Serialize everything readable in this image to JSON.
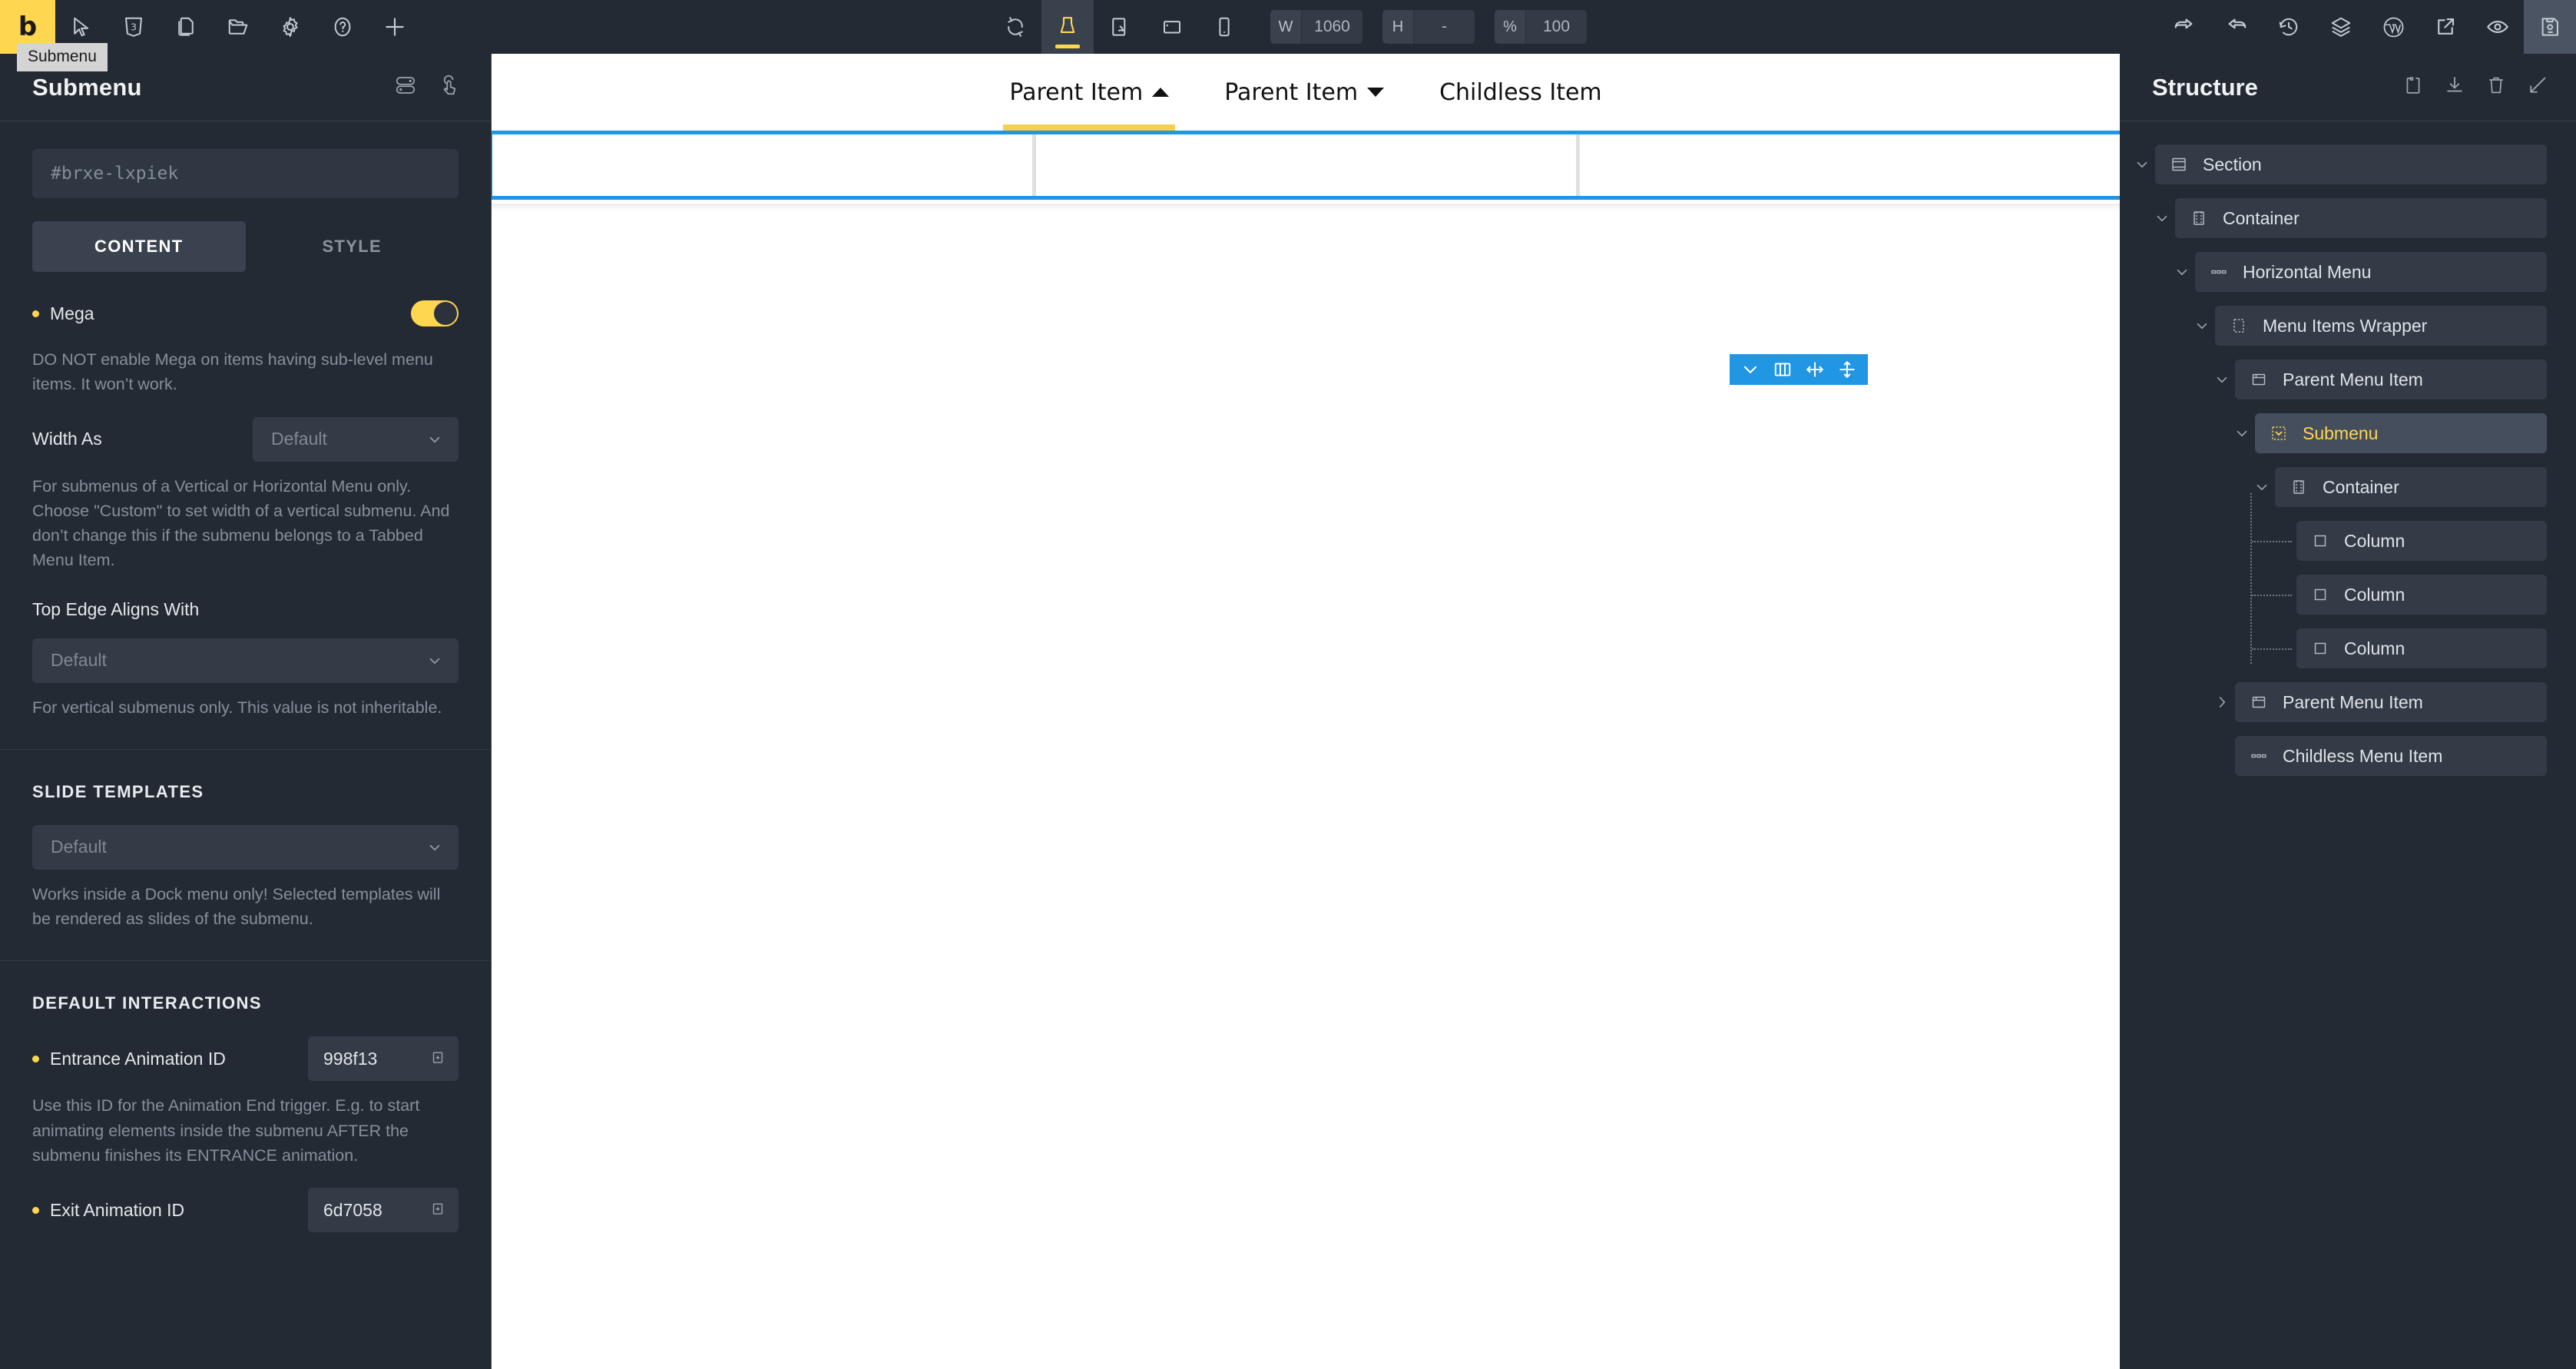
{
  "topbar": {
    "logo": "b",
    "tooltip": "Submenu",
    "left_icons": [
      {
        "name": "cursor-icon",
        "label": "Select"
      },
      {
        "name": "html5-icon",
        "label": "HTML"
      },
      {
        "name": "pages-icon",
        "label": "Pages"
      },
      {
        "name": "folder-icon",
        "label": "Templates"
      },
      {
        "name": "gear-icon",
        "label": "Settings"
      },
      {
        "name": "help-icon",
        "label": "Help"
      },
      {
        "name": "plus-icon",
        "label": "Add Element"
      }
    ],
    "center_icons": [
      {
        "name": "refresh-icon",
        "label": "Refresh"
      },
      {
        "name": "desktop-icon",
        "label": "Desktop",
        "active": true
      },
      {
        "name": "tablet-portrait-icon",
        "label": "Tablet Portrait"
      },
      {
        "name": "tablet-landscape-icon",
        "label": "Tablet Landscape"
      },
      {
        "name": "mobile-icon",
        "label": "Mobile"
      }
    ],
    "fields": [
      {
        "key": "W",
        "value": "1060"
      },
      {
        "key": "H",
        "value": "-"
      },
      {
        "key": "%",
        "value": "100"
      }
    ],
    "right_icons": [
      {
        "name": "undo-icon",
        "label": "Undo"
      },
      {
        "name": "redo-icon",
        "label": "Redo"
      },
      {
        "name": "revisions-icon",
        "label": "Revisions"
      },
      {
        "name": "layers-icon",
        "label": "Layers"
      },
      {
        "name": "wordpress-icon",
        "label": "WordPress"
      },
      {
        "name": "external-link-icon",
        "label": "Open"
      },
      {
        "name": "eye-icon",
        "label": "Preview"
      },
      {
        "name": "save-icon",
        "label": "Save",
        "active": true
      }
    ]
  },
  "left_panel": {
    "title": "Submenu",
    "header_icons": [
      {
        "name": "toggle-settings-icon",
        "label": "Element Settings"
      },
      {
        "name": "interactions-icon",
        "label": "Interactions"
      }
    ],
    "selector": "#brxe-lxpiek",
    "tabs": [
      {
        "label": "CONTENT",
        "active": true
      },
      {
        "label": "STYLE",
        "active": false
      }
    ],
    "mega": {
      "label": "Mega",
      "toggle_on": true,
      "help": "DO NOT enable Mega on items having sub-level menu items. It won’t work."
    },
    "width_as": {
      "label": "Width As",
      "value": "Default",
      "help": "For submenus of a Vertical or Horizontal Menu only. Choose \"Custom\" to set width of a vertical submenu. And don’t change this if the submenu belongs to a Tabbed Menu Item."
    },
    "top_edge": {
      "label": "Top Edge Aligns With",
      "value": "Default",
      "help": "For vertical submenus only. This value is not inheritable."
    },
    "slide_templates": {
      "title": "SLIDE TEMPLATES",
      "value": "Default",
      "help": "Works inside a Dock menu only! Selected templates will be rendered as slides of the submenu."
    },
    "default_interactions": {
      "title": "DEFAULT INTERACTIONS",
      "entrance": {
        "label": "Entrance Animation ID",
        "value": "998f13",
        "help": "Use this ID for the Animation End trigger. E.g. to start animating elements inside the submenu AFTER the submenu finishes its ENTRANCE animation."
      },
      "exit": {
        "label": "Exit Animation ID",
        "value": "6d7058"
      }
    }
  },
  "canvas": {
    "menu_items": [
      {
        "label": "Parent Item",
        "caret": "up",
        "active": true
      },
      {
        "label": "Parent Item",
        "caret": "down",
        "active": false
      },
      {
        "label": "Childless Item",
        "caret": "none",
        "active": false
      }
    ],
    "mega_columns": 3,
    "float_tools": [
      {
        "name": "chevron-down-icon",
        "label": "Select Parent"
      },
      {
        "name": "columns-icon",
        "label": "Columns"
      },
      {
        "name": "resize-horizontal-icon",
        "label": "Resize Width"
      },
      {
        "name": "resize-vertical-icon",
        "label": "Resize Height"
      }
    ],
    "selection_color": "#2196e3",
    "accent_color": "#f5cf52"
  },
  "right_panel": {
    "title": "Structure",
    "header_icons": [
      {
        "name": "clipboard-icon",
        "label": "Paste"
      },
      {
        "name": "download-icon",
        "label": "Import"
      },
      {
        "name": "trash-icon",
        "label": "Delete"
      },
      {
        "name": "collapse-icon",
        "label": "Collapse All"
      }
    ],
    "tree": [
      {
        "label": "Section",
        "icon": "section-icon",
        "depth": 0,
        "chevron": "down",
        "selected": false
      },
      {
        "label": "Container",
        "icon": "container-icon",
        "depth": 1,
        "chevron": "down",
        "selected": false
      },
      {
        "label": "Horizontal Menu",
        "icon": "menu-icon",
        "depth": 2,
        "chevron": "down",
        "selected": false
      },
      {
        "label": "Menu Items Wrapper",
        "icon": "wrapper-icon",
        "depth": 3,
        "chevron": "down",
        "selected": false
      },
      {
        "label": "Parent Menu Item",
        "icon": "menu-item-icon",
        "depth": 4,
        "chevron": "down",
        "selected": false
      },
      {
        "label": "Submenu",
        "icon": "submenu-icon",
        "depth": 5,
        "chevron": "down",
        "selected": true
      },
      {
        "label": "Container",
        "icon": "container-icon",
        "depth": 6,
        "chevron": "down",
        "selected": false
      },
      {
        "label": "Column",
        "icon": "column-icon",
        "depth": 7,
        "chevron": "none",
        "selected": false
      },
      {
        "label": "Column",
        "icon": "column-icon",
        "depth": 7,
        "chevron": "none",
        "selected": false
      },
      {
        "label": "Column",
        "icon": "column-icon",
        "depth": 7,
        "chevron": "none",
        "selected": false
      },
      {
        "label": "Parent Menu Item",
        "icon": "menu-item-icon",
        "depth": 4,
        "chevron": "right",
        "selected": false
      },
      {
        "label": "Childless Menu Item",
        "icon": "menu-icon",
        "depth": 4,
        "chevron": "none",
        "selected": false
      }
    ]
  }
}
